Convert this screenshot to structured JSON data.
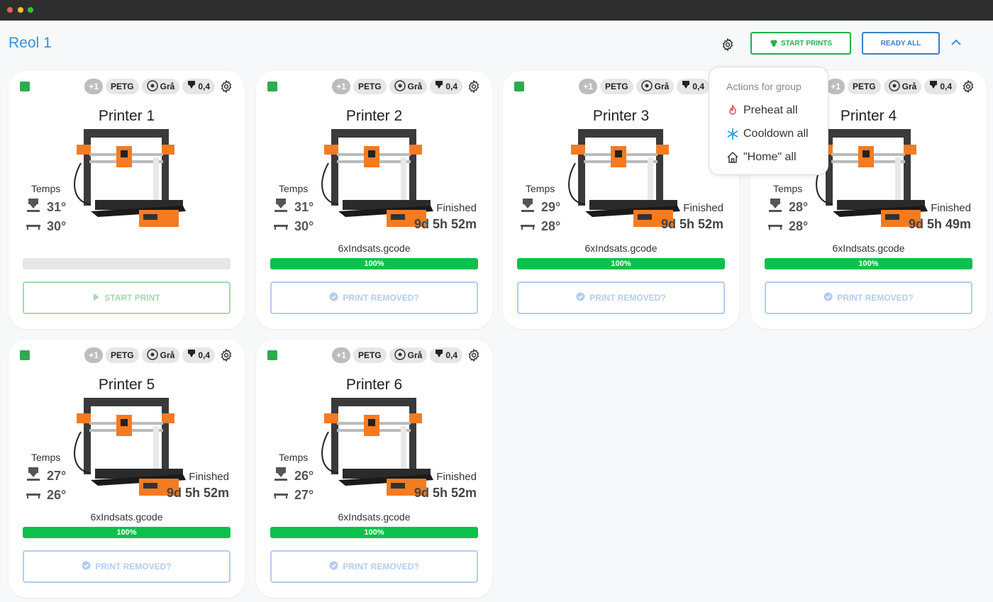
{
  "header": {
    "group_title": "Reol 1",
    "start_prints_label": "START PRINTS",
    "ready_all_label": "READY ALL"
  },
  "dropdown": {
    "title": "Actions for group",
    "items": [
      "Preheat all",
      "Cooldown all",
      "\"Home\" all"
    ]
  },
  "card_labels": {
    "temps": "Temps",
    "finished": "Finished",
    "start_print": "START PRINT",
    "print_removed": "PRINT REMOVED?"
  },
  "chips": {
    "plus": "+1",
    "material": "PETG",
    "color": "Grå",
    "nozzle": "0,4"
  },
  "printers": [
    {
      "name": "Printer 1",
      "hotend": "31°",
      "bed": "30°",
      "finished": false,
      "eta": "",
      "file": "",
      "progress": "",
      "action": "start"
    },
    {
      "name": "Printer 2",
      "hotend": "31°",
      "bed": "30°",
      "finished": true,
      "eta": "9d 5h 52m",
      "file": "6xIndsats.gcode",
      "progress": "100%",
      "action": "removed"
    },
    {
      "name": "Printer 3",
      "hotend": "29°",
      "bed": "28°",
      "finished": true,
      "eta": "9d 5h 52m",
      "file": "6xIndsats.gcode",
      "progress": "100%",
      "action": "removed"
    },
    {
      "name": "Printer 4",
      "hotend": "28°",
      "bed": "28°",
      "finished": true,
      "eta": "9d 5h 49m",
      "file": "6xIndsats.gcode",
      "progress": "100%",
      "action": "removed"
    },
    {
      "name": "Printer 5",
      "hotend": "27°",
      "bed": "26°",
      "finished": true,
      "eta": "9d 5h 52m",
      "file": "6xIndsats.gcode",
      "progress": "100%",
      "action": "removed"
    },
    {
      "name": "Printer 6",
      "hotend": "26°",
      "bed": "27°",
      "finished": true,
      "eta": "9d 5h 52m",
      "file": "6xIndsats.gcode",
      "progress": "100%",
      "action": "removed"
    }
  ],
  "colors": {
    "accent_blue": "#3b8fd6",
    "status_green": "#2eab4d",
    "progress_green": "#0bc14b"
  },
  "icons": [
    "gear-icon",
    "recycle-icon",
    "chevron-up-icon",
    "hotend-icon",
    "bed-icon",
    "spool-icon",
    "nozzle-icon",
    "play-icon",
    "check-circle-icon",
    "flame-icon",
    "snowflake-icon",
    "home-icon"
  ]
}
